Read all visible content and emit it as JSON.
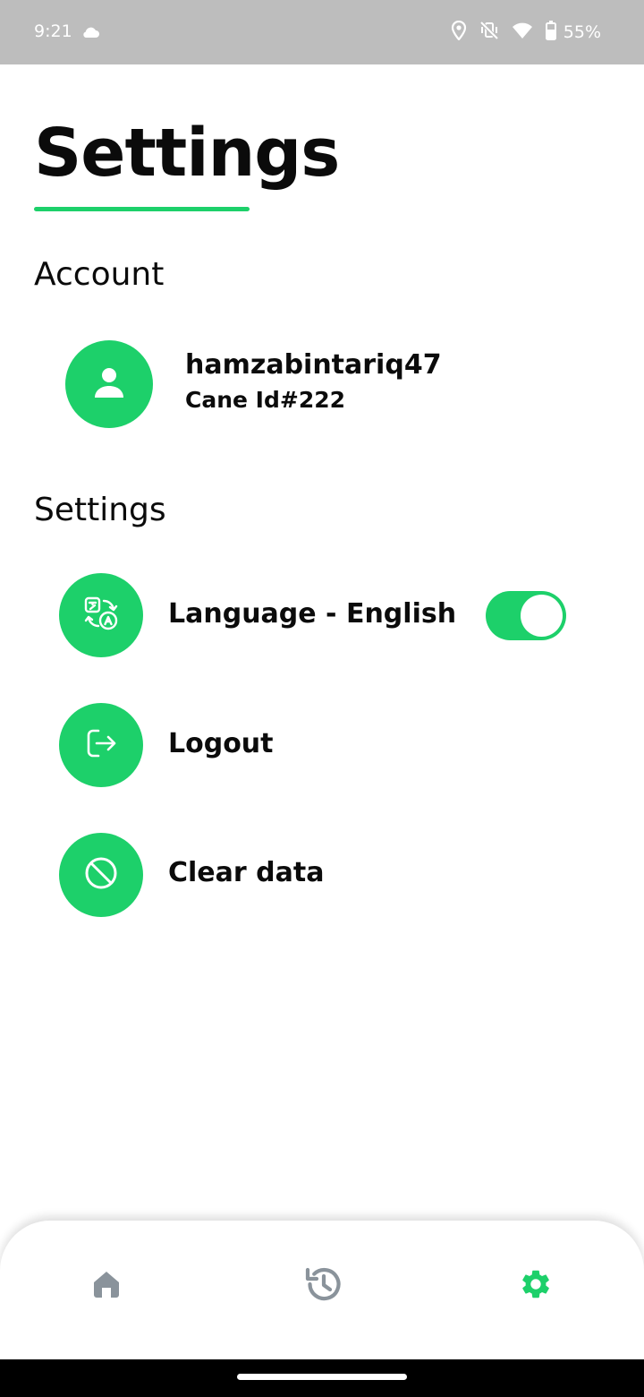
{
  "status_bar": {
    "time": "9:21",
    "battery": "55%",
    "icons": [
      "cloud-icon",
      "location-icon",
      "vibrate-off-icon",
      "wifi-icon",
      "battery-icon"
    ]
  },
  "page": {
    "title": "Settings"
  },
  "account": {
    "section_title": "Account",
    "username": "hamzabintariq47",
    "cane_id": "Cane Id#222",
    "avatar_icon": "person-icon"
  },
  "settings": {
    "section_title": "Settings",
    "items": [
      {
        "label": "Language - English",
        "icon": "translate-icon",
        "toggle_on": true
      },
      {
        "label": "Logout",
        "icon": "logout-icon"
      },
      {
        "label": "Clear data",
        "icon": "block-icon"
      }
    ]
  },
  "bottom_nav": {
    "items": [
      {
        "icon": "home-icon",
        "active": false
      },
      {
        "icon": "history-icon",
        "active": false
      },
      {
        "icon": "gear-icon",
        "active": true
      }
    ]
  },
  "colors": {
    "accent": "#1dd06a",
    "status_bar": "#bdbdbd",
    "nav_inactive": "#8a939b",
    "text": "#0b0b0b"
  }
}
